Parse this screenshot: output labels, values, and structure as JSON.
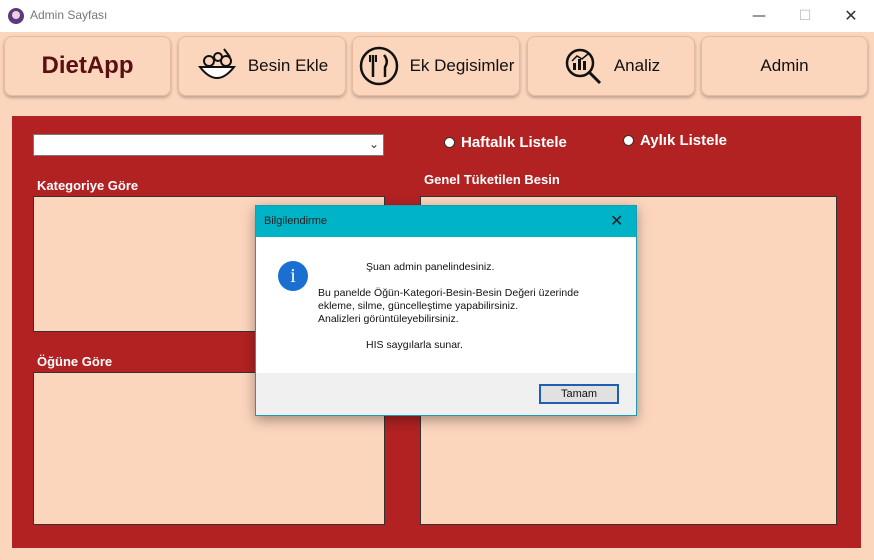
{
  "window": {
    "title": "Admin Sayfası"
  },
  "nav": {
    "brand": "DietApp",
    "besin_ekle": "Besin Ekle",
    "ek_degisimler": "Ek Degisimler",
    "analiz": "Analiz",
    "admin": "Admin"
  },
  "filters": {
    "weekly": "Haftalık Listele",
    "monthly": "Aylık Listele",
    "combo_value": ""
  },
  "sections": {
    "by_category": "Kategoriye Göre",
    "by_meal": "Öğüne Göre",
    "general": "Genel Tüketilen Besin"
  },
  "dialog": {
    "title": "Bilgilendirme",
    "line1": "Şuan admin panelindesiniz.",
    "line2": "Bu panelde Öğün-Kategori-Besin-Besin Değeri üzerinde",
    "line3": "ekleme, silme, güncelleştime yapabilirsiniz.",
    "line4": "Analizleri görüntüleyebilirsiniz.",
    "line5": "HIS saygılarla sunar.",
    "ok": "Tamam"
  },
  "colors": {
    "panel": "#b22222",
    "background": "#fcd5bd",
    "dialog_title": "#00b3c6",
    "brand": "#5a0f12"
  }
}
